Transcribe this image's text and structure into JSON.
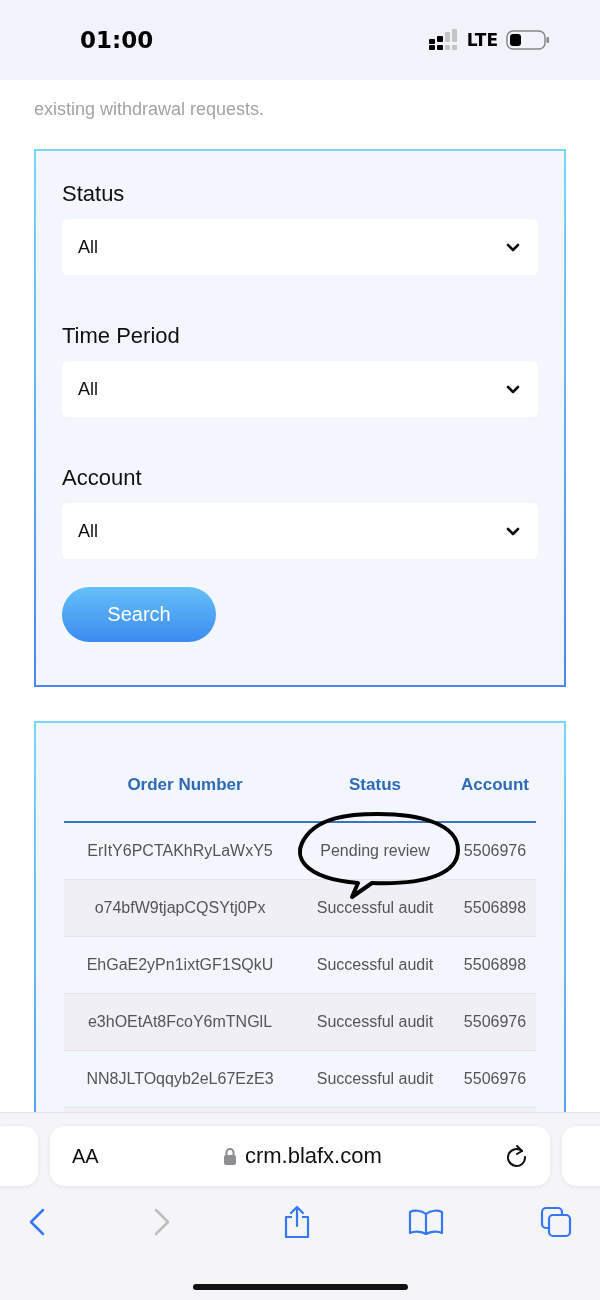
{
  "status_bar": {
    "time": "01:00",
    "network": "LTE"
  },
  "intro_text": [
    "existing withdrawal requests."
  ],
  "filters": [
    {
      "label": "Status",
      "value": "All"
    },
    {
      "label": "Time Period",
      "value": "All"
    },
    {
      "label": "Account",
      "value": "All"
    }
  ],
  "search_button": "Search",
  "table": {
    "columns": [
      "Order Number",
      "Status",
      "Account"
    ],
    "rows": [
      {
        "order_number": "ErItY6PCTAKhRyLaWxY5",
        "status": "Pending review",
        "account": "5506976"
      },
      {
        "order_number": "o74bfW9tjapCQSYtj0Px",
        "status": "Successful audit",
        "account": "5506898"
      },
      {
        "order_number": "EhGaE2yPn1ixtGF1SQkU",
        "status": "Successful audit",
        "account": "5506898"
      },
      {
        "order_number": "e3hOEtAt8FcoY6mTNGlL",
        "status": "Successful audit",
        "account": "5506976"
      },
      {
        "order_number": "NN8JLTOqqyb2eL67EzE3",
        "status": "Successful audit",
        "account": "5506976"
      }
    ]
  },
  "browser": {
    "text_size_button": "AA",
    "url": "crm.blafx.com"
  }
}
